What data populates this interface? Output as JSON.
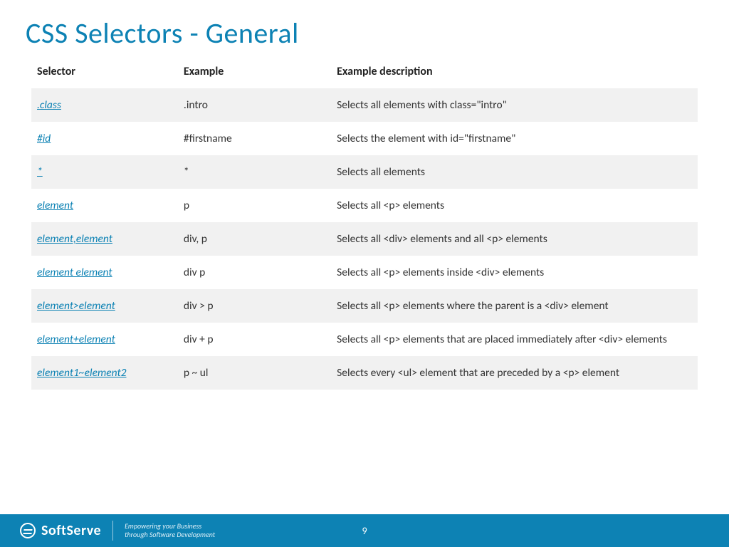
{
  "title": "CSS Selectors - General",
  "columns": {
    "selector": "Selector",
    "example": "Example",
    "description": "Example description"
  },
  "rows": [
    {
      "selector": ".class",
      "example": ".intro",
      "description": "Selects all elements with class=\"intro\""
    },
    {
      "selector": "#id",
      "example": "#firstname",
      "description": "Selects the element with id=\"firstname\""
    },
    {
      "selector": "*",
      "example": "*",
      "description": "Selects all elements"
    },
    {
      "selector": "element",
      "example": "p",
      "description": "Selects all <p> elements"
    },
    {
      "selector": "element,element",
      "example": "div, p",
      "description": "Selects all <div> elements and all <p> elements"
    },
    {
      "selector": "element element",
      "example": "div p",
      "description": "Selects all <p> elements inside <div> elements"
    },
    {
      "selector": "element>element",
      "example": "div > p",
      "description": "Selects all <p> elements where the parent is a <div> element"
    },
    {
      "selector": "element+element",
      "example": "div + p",
      "description": "Selects all <p> elements that are placed immediately after <div> elements"
    },
    {
      "selector": "element1~element2",
      "example": "p ~ ul",
      "description": "Selects every <ul> element that are preceded by a <p> element"
    }
  ],
  "footer": {
    "brand": "SoftServe",
    "tagline_line1": "Empowering your Business",
    "tagline_line2": "through Software Development",
    "page_number": "9"
  }
}
